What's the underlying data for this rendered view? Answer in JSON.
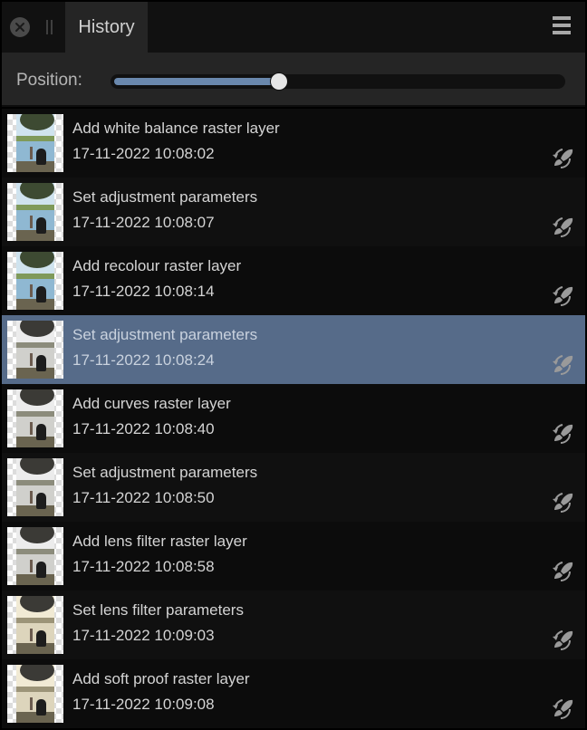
{
  "tab_bar": {
    "close_icon": "close-circle-icon",
    "grip_icon": "drag-grip-icon",
    "active_tab": "History",
    "menu_icon": "hamburger-menu-icon"
  },
  "position": {
    "label": "Position:",
    "value_fraction": 0.37
  },
  "colors": {
    "accent": "#6a88ad",
    "selected_row": "#566b89",
    "panel_bg": "#252525",
    "tab_bar_bg": "#111111"
  },
  "history": [
    {
      "title": "Add white balance raster layer",
      "timestamp": "17-11-2022 10:08:02",
      "tone": "color",
      "icon": "brush-undo-icon",
      "selected": false
    },
    {
      "title": "Set adjustment parameters",
      "timestamp": "17-11-2022 10:08:07",
      "tone": "color",
      "icon": "brush-undo-icon",
      "selected": false
    },
    {
      "title": "Add recolour raster layer",
      "timestamp": "17-11-2022 10:08:14",
      "tone": "color",
      "icon": "brush-undo-icon",
      "selected": false
    },
    {
      "title": "Set adjustment parameters",
      "timestamp": "17-11-2022 10:08:24",
      "tone": "mono",
      "icon": "brush-undo-icon",
      "selected": true
    },
    {
      "title": "Add curves raster layer",
      "timestamp": "17-11-2022 10:08:40",
      "tone": "mono",
      "icon": "brush-undo-icon",
      "selected": false
    },
    {
      "title": "Set adjustment parameters",
      "timestamp": "17-11-2022 10:08:50",
      "tone": "mono",
      "icon": "brush-undo-icon",
      "selected": false
    },
    {
      "title": "Add lens filter raster layer",
      "timestamp": "17-11-2022 10:08:58",
      "tone": "mono",
      "icon": "brush-undo-icon",
      "selected": false
    },
    {
      "title": "Set lens filter parameters",
      "timestamp": "17-11-2022 10:09:03",
      "tone": "sepia",
      "icon": "brush-undo-icon",
      "selected": false
    },
    {
      "title": "Add soft proof raster layer",
      "timestamp": "17-11-2022 10:09:08",
      "tone": "sepia",
      "icon": "brush-undo-icon",
      "selected": false
    }
  ]
}
